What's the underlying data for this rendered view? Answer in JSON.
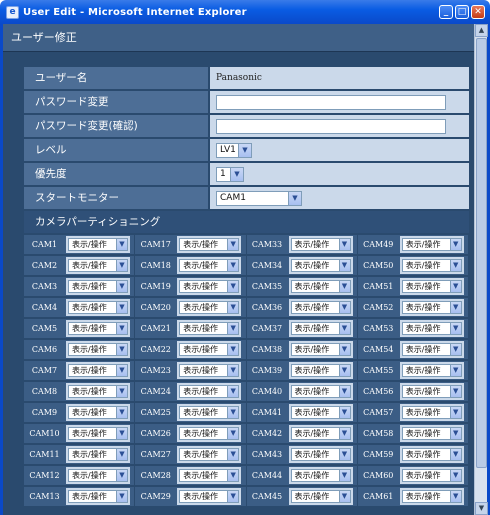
{
  "window": {
    "title": "User Edit - Microsoft Internet Explorer",
    "controls": {
      "minimize": "_",
      "maximize": "□",
      "close": "✕"
    }
  },
  "page": {
    "header": "ユーザー修正"
  },
  "form": {
    "username": {
      "label": "ユーザー名",
      "value": "Panasonic"
    },
    "password": {
      "label": "パスワード変更",
      "value": ""
    },
    "password_confirm": {
      "label": "パスワード変更(確認)",
      "value": ""
    },
    "level": {
      "label": "レベル",
      "value": "LV1"
    },
    "priority": {
      "label": "優先度",
      "value": "1"
    },
    "start_monitor": {
      "label": "スタートモニター",
      "value": "CAM1"
    }
  },
  "camera_partition": {
    "label": "カメラパーティショニング",
    "option_label": "表示/操作",
    "columns": [
      [
        "CAM1",
        "CAM2",
        "CAM3",
        "CAM4",
        "CAM5",
        "CAM6",
        "CAM7",
        "CAM8",
        "CAM9",
        "CAM10",
        "CAM11",
        "CAM12",
        "CAM13"
      ],
      [
        "CAM17",
        "CAM18",
        "CAM19",
        "CAM20",
        "CAM21",
        "CAM22",
        "CAM23",
        "CAM24",
        "CAM25",
        "CAM26",
        "CAM27",
        "CAM28",
        "CAM29"
      ],
      [
        "CAM33",
        "CAM34",
        "CAM35",
        "CAM36",
        "CAM37",
        "CAM38",
        "CAM39",
        "CAM40",
        "CAM41",
        "CAM42",
        "CAM43",
        "CAM44",
        "CAM45"
      ],
      [
        "CAM49",
        "CAM50",
        "CAM51",
        "CAM52",
        "CAM53",
        "CAM54",
        "CAM55",
        "CAM56",
        "CAM57",
        "CAM58",
        "CAM59",
        "CAM60",
        "CAM61"
      ]
    ]
  },
  "icons": {
    "app": "ie-icon",
    "dropdown": "chevron-down-icon",
    "scroll_up": "scroll-up-icon",
    "scroll_down": "scroll-down-icon"
  },
  "colors": {
    "titlebar": "#0a5ce3",
    "background": "#2a4a6e",
    "label_cell": "#4d6e96",
    "value_cell": "#cbd9ea"
  }
}
